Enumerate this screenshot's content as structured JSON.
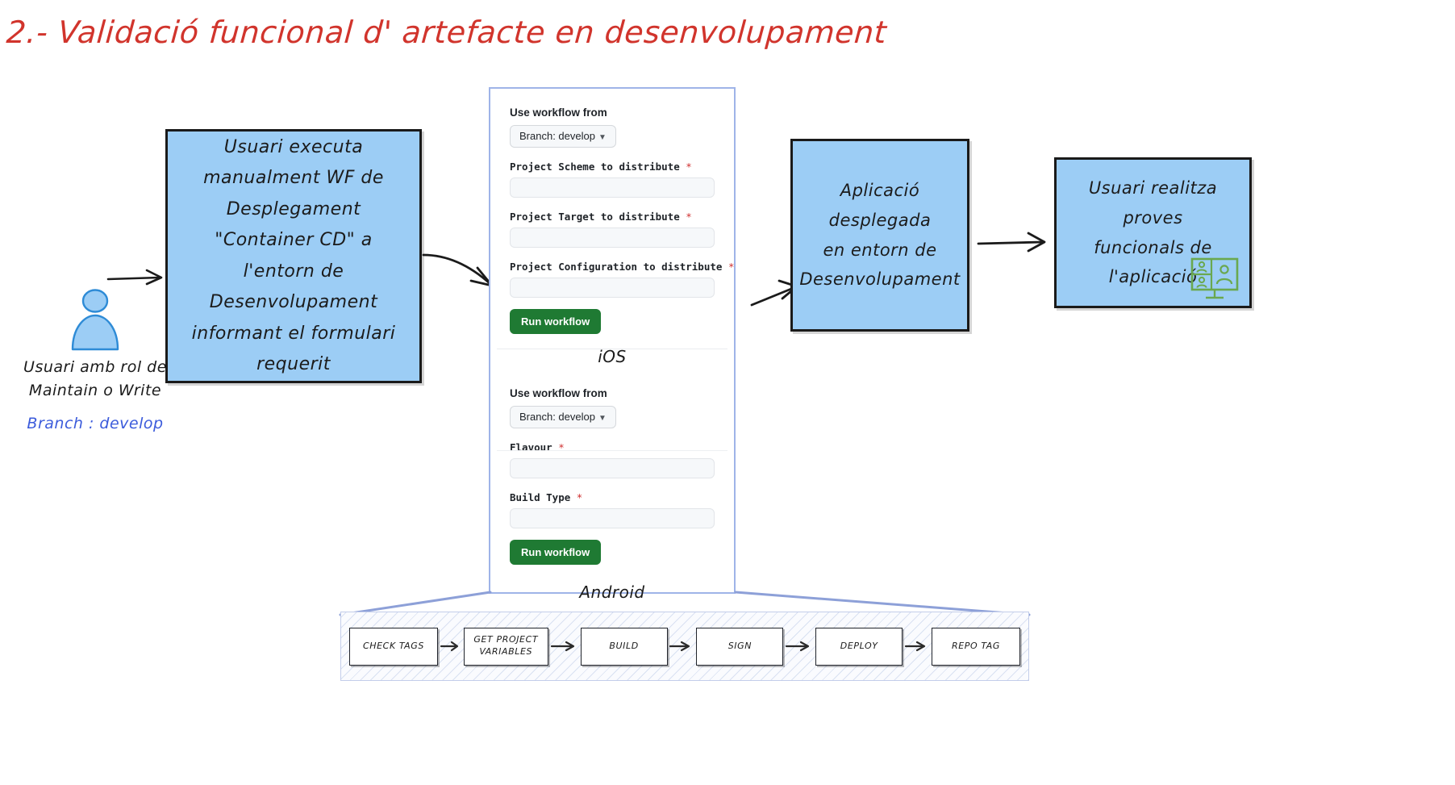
{
  "title": "2.- Validació funcional d' artefacte en desenvolupament",
  "colors": {
    "title_red": "#d1342c",
    "box_blue_fill": "#9ccdf5",
    "box_border": "#1a1a1a",
    "branch_blue_text": "#3b5bdb",
    "panel_border": "#9fb4e8",
    "run_button_green": "#1f7a33",
    "required_red": "#cf2e2e",
    "monitor_icon_green": "#6aa84f",
    "hatch_blue": "#8ca5d7"
  },
  "actor": {
    "icon": "person-icon",
    "label_line1": "Usuari amb rol de",
    "label_line2": "Maintain o Write",
    "branch_note": "Branch : develop"
  },
  "boxes": {
    "execute": {
      "line1": "Usuari executa manualment WF de",
      "line2": "Desplegament \"Container CD\" a",
      "line3": "l'entorn de Desenvolupament",
      "line4": "informant el formulari requerit"
    },
    "deployed": {
      "line1": "Aplicació desplegada",
      "line2": "en entorn de",
      "line3": "Desenvolupament"
    },
    "tests": {
      "line1": "Usuari realitza proves",
      "line2": "funcionals de l'aplicació",
      "icon": "video-conference-monitor-icon"
    }
  },
  "form_panel": {
    "ios": {
      "use_workflow_from_label": "Use workflow from",
      "branch_button": "Branch: develop",
      "branch_caret_icon": "chevron-down-icon",
      "fields": [
        {
          "label": "Project Scheme to distribute",
          "required": "*",
          "value": ""
        },
        {
          "label": "Project Target to distribute",
          "required": "*",
          "value": ""
        },
        {
          "label": "Project Configuration to distribute",
          "required": "*",
          "value": ""
        }
      ],
      "run_button": "Run workflow",
      "caption": "iOS"
    },
    "android": {
      "use_workflow_from_label": "Use workflow from",
      "branch_button": "Branch: develop",
      "branch_caret_icon": "chevron-down-icon",
      "fields": [
        {
          "label": "Flavour",
          "required": "*",
          "value": ""
        },
        {
          "label": "Build Type",
          "required": "*",
          "value": ""
        }
      ],
      "run_button": "Run workflow",
      "caption": "Android"
    }
  },
  "pipeline": {
    "steps": [
      {
        "label": "CHECK TAGS"
      },
      {
        "label": "GET PROJECT\nVARIABLES"
      },
      {
        "label": "BUILD"
      },
      {
        "label": "SIGN"
      },
      {
        "label": "DEPLOY"
      },
      {
        "label": "REPO TAG"
      }
    ]
  }
}
